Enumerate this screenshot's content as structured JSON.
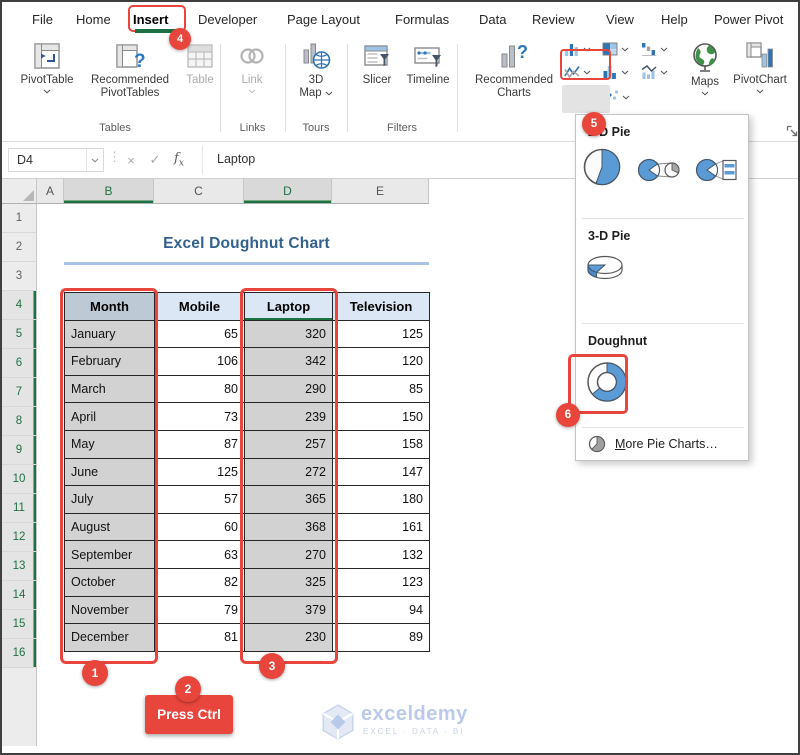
{
  "window": {
    "tabs": [
      "File",
      "Home",
      "Insert",
      "Developer",
      "Page Layout",
      "Formulas",
      "Data",
      "Review",
      "View",
      "Help",
      "Power Pivot"
    ],
    "active_tab": "Insert"
  },
  "ribbon": {
    "tables": {
      "label": "Tables",
      "pivotTable": "PivotTable",
      "recommendedPivotTables": "Recommended PivotTables",
      "table": "Table"
    },
    "links": {
      "label": "Links",
      "link": "Link"
    },
    "tours": {
      "label": "Tours",
      "map3d_line1": "3D",
      "map3d_line2": "Map"
    },
    "filters": {
      "label": "Filters",
      "slicer": "Slicer",
      "timeline": "Timeline"
    },
    "charts": {
      "recommendedCharts_line1": "Recommended",
      "recommendedCharts_line2": "Charts",
      "maps": "Maps",
      "pivotChart": "PivotChart"
    },
    "chart_buttons": [
      "column-chart-icon",
      "hierarchy-chart-icon",
      "waterfall-chart-icon",
      "line-chart-icon",
      "statistic-chart-icon",
      "combo-chart-icon",
      "pie-chart-icon",
      "scatter-chart-icon"
    ],
    "big_button_icons": [
      "pivottable-icon",
      "recommended-pivottables-icon",
      "table-icon",
      "link-icon",
      "3d-map-icon",
      "slicer-icon",
      "timeline-icon",
      "recommended-charts-icon",
      "maps-globe-icon",
      "pivotchart-icon",
      "dialog-launcher-icon"
    ]
  },
  "formula_bar": {
    "name_box": "D4",
    "formula": "Laptop"
  },
  "pie_menu": {
    "section_2d": "2-D Pie",
    "section_3d": "3-D Pie",
    "section_doughnut": "Doughnut",
    "more_prefix": "M",
    "more_suffix": "ore Pie Charts…",
    "icons": [
      "pie-2d-icon",
      "pie-of-pie-icon",
      "bar-of-pie-icon",
      "pie-3d-icon",
      "doughnut-icon",
      "more-pie-icon"
    ]
  },
  "sheet": {
    "title": "Excel Doughnut Chart",
    "columns": [
      "A",
      "B",
      "C",
      "D",
      "E"
    ],
    "selected_columns": [
      "B",
      "D"
    ],
    "row_numbers": [
      1,
      2,
      3,
      4,
      5,
      6,
      7,
      8,
      9,
      10,
      11,
      12,
      13,
      14,
      15,
      16
    ],
    "selected_rows_from": 4,
    "table": {
      "headers": [
        "Month",
        "Mobile",
        "Laptop",
        "Television"
      ],
      "rows": [
        [
          "January",
          "65",
          "320",
          "125"
        ],
        [
          "February",
          "106",
          "342",
          "120"
        ],
        [
          "March",
          "80",
          "290",
          "85"
        ],
        [
          "April",
          "73",
          "239",
          "150"
        ],
        [
          "May",
          "87",
          "257",
          "158"
        ],
        [
          "June",
          "125",
          "272",
          "147"
        ],
        [
          "July",
          "57",
          "365",
          "180"
        ],
        [
          "August",
          "60",
          "368",
          "161"
        ],
        [
          "September",
          "63",
          "270",
          "132"
        ],
        [
          "October",
          "82",
          "325",
          "123"
        ],
        [
          "November",
          "79",
          "379",
          "94"
        ],
        [
          "December",
          "81",
          "230",
          "89"
        ]
      ]
    }
  },
  "annotations": {
    "step1": "1",
    "step2": "2",
    "step3": "3",
    "step4": "4",
    "step5": "5",
    "step6": "6",
    "press_ctrl": "Press Ctrl"
  },
  "watermark": {
    "brand": "exceldemy",
    "tagline": "EXCEL · DATA · BI"
  },
  "colors": {
    "accent_red": "#E8453C",
    "excel_green": "#1D7044",
    "header_blue": "#DBE7F4",
    "selected_gray": "#D2D2D2",
    "chart_blue": "#5B9BD5",
    "title_blue": "#33618E",
    "title_underline_blue": "#A9C3E6"
  }
}
